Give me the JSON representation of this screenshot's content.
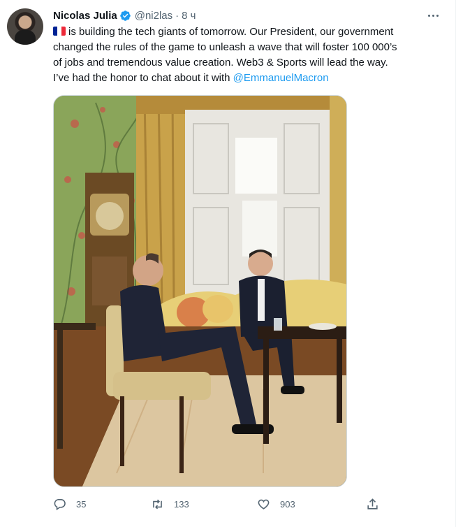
{
  "tweet": {
    "author_name": "Nicolas Julia",
    "author_handle": "@ni2las",
    "time_separator": "·",
    "time": "8 ч",
    "text_line1": "is building the tech giants of tomorrow. Our President, our government",
    "text_line2": "changed the rules of the game to unleash a wave that will foster 100 000’s",
    "text_line3": "of jobs and tremendous value creation. Web3 & Sports will lead the way.",
    "text_line4_prefix": "I’ve had the honor to chat about it with ",
    "mention": "@EmmanuelMacron"
  },
  "actions": {
    "reply_count": "35",
    "retweet_count": "133",
    "like_count": "903"
  },
  "icons": {
    "verified": "verified-badge-icon",
    "more": "more-options-icon",
    "reply": "reply-icon",
    "retweet": "retweet-icon",
    "like": "heart-icon",
    "share": "share-icon",
    "flag": "france-flag-icon"
  },
  "colors": {
    "accent": "#1d9bf0",
    "secondary_text": "#536471",
    "flag_blue": "#002395",
    "flag_white": "#ffffff",
    "flag_red": "#ed2939"
  }
}
